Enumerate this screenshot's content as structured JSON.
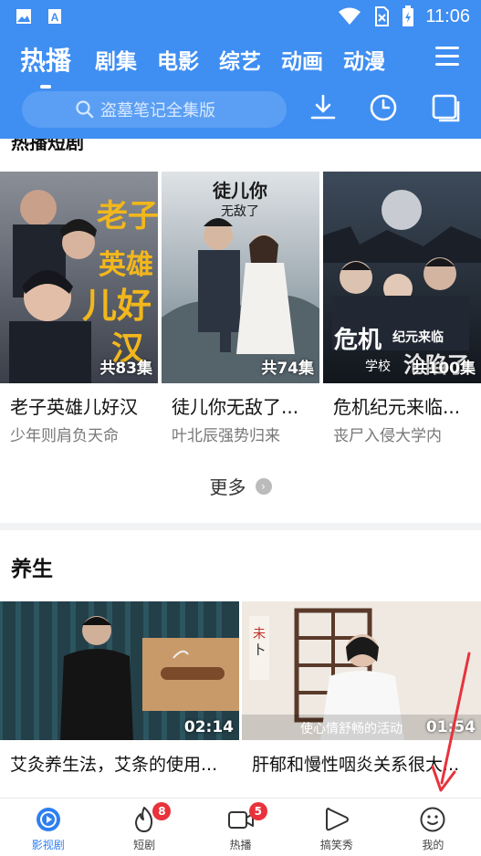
{
  "status_bar": {
    "time": "11:06",
    "icons": [
      "gallery-icon",
      "app-a-icon",
      "wifi-icon",
      "sim-off-icon",
      "battery-icon"
    ]
  },
  "header": {
    "tabs": [
      {
        "label": "热播",
        "active": true
      },
      {
        "label": "剧集",
        "active": false
      },
      {
        "label": "电影",
        "active": false
      },
      {
        "label": "综艺",
        "active": false
      },
      {
        "label": "动画",
        "active": false
      },
      {
        "label": "动漫",
        "active": false
      }
    ],
    "search_placeholder": "盗墓笔记全集版",
    "icons": [
      "download-icon",
      "history-icon",
      "window-icon",
      "menu-icon"
    ]
  },
  "hot_dramas": {
    "section_title": "热播短剧",
    "items": [
      {
        "title": "老子英雄儿好汉",
        "subtitle": "少年则肩负天命",
        "episodes": "共83集",
        "poster_text": "老子英雄儿好汉"
      },
      {
        "title": "徒儿你无敌了...",
        "subtitle": "叶北辰强势归来",
        "episodes": "共74集",
        "poster_text": "徒儿你无敌了"
      },
      {
        "title": "危机纪元来临...",
        "subtitle": "丧尸入侵大学内",
        "episodes": "共100集",
        "poster_text": "危机纪元来临 学校沦陷了"
      }
    ],
    "more_label": "更多"
  },
  "health": {
    "section_title": "养生",
    "items": [
      {
        "title": "艾灸养生法，艾条的使用...",
        "duration": "02:14"
      },
      {
        "title": "肝郁和慢性咽炎关系很大...",
        "duration": "01:54",
        "thumb_caption": "使心情舒畅的活动"
      }
    ]
  },
  "bottom_nav": [
    {
      "label": "影视剧",
      "icon": "play-circle-icon",
      "active": true,
      "badge": ""
    },
    {
      "label": "短剧",
      "icon": "flame-icon",
      "active": false,
      "badge": "8"
    },
    {
      "label": "热播",
      "icon": "video-camera-icon",
      "active": false,
      "badge": "5"
    },
    {
      "label": "搞笑秀",
      "icon": "play-outline-icon",
      "active": false,
      "badge": ""
    },
    {
      "label": "我的",
      "icon": "smile-icon",
      "active": false,
      "badge": ""
    }
  ],
  "colors": {
    "brand_blue": "#3f8ef2",
    "badge_red": "#e8323c",
    "active_nav": "#2f7ff1",
    "annotation_arrow": "#e8323c"
  }
}
